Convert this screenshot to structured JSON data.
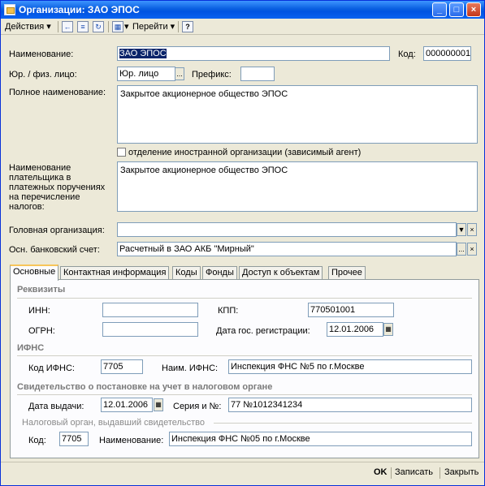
{
  "window": {
    "title": "Организации: ЗАО ЭПОС"
  },
  "toolbar": {
    "actions_label": "Действия",
    "goto_label": "Перейти",
    "help_label": "?"
  },
  "main": {
    "name_label": "Наименование:",
    "name_value": "ЗАО ЭПОС",
    "code_label": "Код:",
    "code_value": "000000001",
    "entity_type_label": "Юр. / физ. лицо:",
    "entity_type_value": "Юр. лицо",
    "prefix_label": "Префикс:",
    "prefix_value": "",
    "full_name_label": "Полное наименование:",
    "full_name_value": "Закрытое акционерное общество ЭПОС",
    "foreign_branch_label": "отделение иностранной организации (зависимый агент)",
    "foreign_branch_checked": false,
    "payer_name_label": "Наименование плательщика в платежных поручениях на перечисление налогов:",
    "payer_name_value": "Закрытое акционерное общество ЭПОС",
    "head_org_label": "Головная организация:",
    "head_org_value": "",
    "bank_account_label": "Осн. банковский счет:",
    "bank_account_value": "Расчетный в ЗАО АКБ \"Мирный\"",
    "ellipsis": "...",
    "clear": "×",
    "dropdown": "▼"
  },
  "tabs": [
    "Основные",
    "Контактная информация",
    "Коды",
    "Фонды",
    "Доступ к объектам",
    "Прочее"
  ],
  "details": {
    "section_title": "Реквизиты",
    "inn_label": "ИНН:",
    "inn_value": "",
    "kpp_label": "КПП:",
    "kpp_value": "770501001",
    "ogrn_label": "ОГРН:",
    "ogrn_value": "",
    "reg_date_label": "Дата гос. регистрации:",
    "reg_date_value": "12.01.2006"
  },
  "ifns": {
    "section_title": "ИФНС",
    "code_label": "Код ИФНС:",
    "code_value": "7705",
    "name_label": "Наим. ИФНС:",
    "name_value": "Инспекция ФНС №5 по г.Москве"
  },
  "certificate": {
    "section_title": "Свидетельство о постановке на учет в налоговом органе",
    "issue_date_label": "Дата выдачи:",
    "issue_date_value": "12.01.2006",
    "series_label": "Серия и №:",
    "series_value": "77 №1012341234",
    "issuer_title": "Налоговый орган, выдавший свидетельство",
    "issuer_code_label": "Код:",
    "issuer_code_value": "7705",
    "issuer_name_label": "Наименование:",
    "issuer_name_value": "Инспекция ФНС №05 по г.Москве"
  },
  "footer": {
    "ok": "OK",
    "save": "Записать",
    "close": "Закрыть"
  }
}
